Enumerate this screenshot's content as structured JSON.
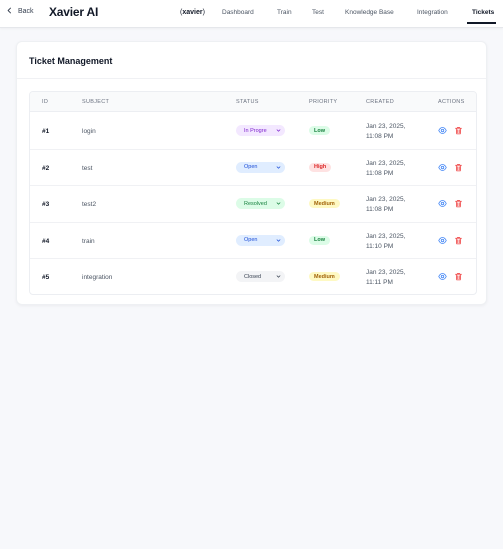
{
  "header": {
    "back_label": "Back",
    "app_title": "Xavier AI",
    "agent_open": "(",
    "agent_name": "xavier",
    "agent_close": ")",
    "nav": [
      {
        "label": "Dashboard",
        "active": false
      },
      {
        "label": "Train",
        "active": false
      },
      {
        "label": "Test",
        "active": false
      },
      {
        "label": "Knowledge Base",
        "active": false
      },
      {
        "label": "Integration",
        "active": false
      },
      {
        "label": "Tickets",
        "active": true
      }
    ]
  },
  "card": {
    "title": "Ticket Management"
  },
  "table": {
    "columns": [
      "ID",
      "SUBJECT",
      "STATUS",
      "PRIORITY",
      "CREATED",
      "ACTIONS"
    ],
    "rows": [
      {
        "id": "#1",
        "subject": "login",
        "status": "In Progre",
        "priority": "Low",
        "created_date": "Jan 23, 2025,",
        "created_time": "11:08 PM"
      },
      {
        "id": "#2",
        "subject": "test",
        "status": "Open",
        "priority": "High",
        "created_date": "Jan 23, 2025,",
        "created_time": "11:08 PM"
      },
      {
        "id": "#3",
        "subject": "test2",
        "status": "Resolved",
        "priority": "Medium",
        "created_date": "Jan 23, 2025,",
        "created_time": "11:08 PM"
      },
      {
        "id": "#4",
        "subject": "train",
        "status": "Open",
        "priority": "Low",
        "created_date": "Jan 23, 2025,",
        "created_time": "11:10 PM"
      },
      {
        "id": "#5",
        "subject": "integration",
        "status": "Closed",
        "priority": "Medium",
        "created_date": "Jan 23, 2025,",
        "created_time": "11:11 PM"
      }
    ]
  },
  "colors": {
    "accent": "#111827",
    "view_icon": "#3b82f6",
    "delete_icon": "#ef4444"
  },
  "icons": {
    "back": "chevron-left-icon",
    "status_dropdown": "chevron-down-icon",
    "view": "eye-icon",
    "delete": "trash-icon"
  }
}
